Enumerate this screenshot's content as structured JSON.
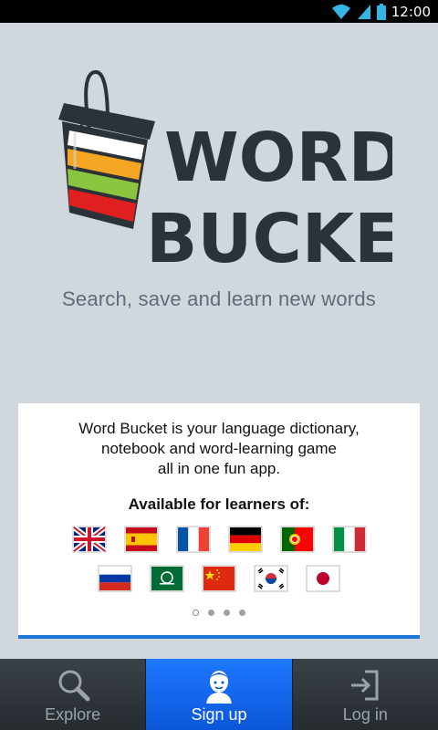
{
  "status_bar": {
    "time": "12:00"
  },
  "logo": {
    "line1": "WORD",
    "line2": "BUCKET"
  },
  "tagline": "Search, save and learn new words",
  "card": {
    "description_lines": [
      "Word Bucket is your language dictionary,",
      "notebook and word-learning game",
      "all in one fun app."
    ],
    "available_label": "Available for learners of:",
    "flags_row1": [
      "uk-flag-icon",
      "spain-flag-icon",
      "france-flag-icon",
      "germany-flag-icon",
      "portugal-flag-icon",
      "italy-flag-icon"
    ],
    "flags_row2": [
      "russia-flag-icon",
      "saudi-arabia-flag-icon",
      "china-flag-icon",
      "south-korea-flag-icon",
      "japan-flag-icon"
    ],
    "pager": {
      "pages": 4,
      "active_index": 0
    }
  },
  "bottom_nav": {
    "tabs": [
      {
        "label": "Explore",
        "icon": "magnifier-icon",
        "active": false
      },
      {
        "label": "Sign up",
        "icon": "user-icon",
        "active": true
      },
      {
        "label": "Log in",
        "icon": "login-arrow-icon",
        "active": false
      }
    ]
  },
  "colors": {
    "background": "#d0d7dd",
    "accent_blue": "#1976d2",
    "logo_text": "#2b3238",
    "active_tab": "#1e78ff"
  }
}
